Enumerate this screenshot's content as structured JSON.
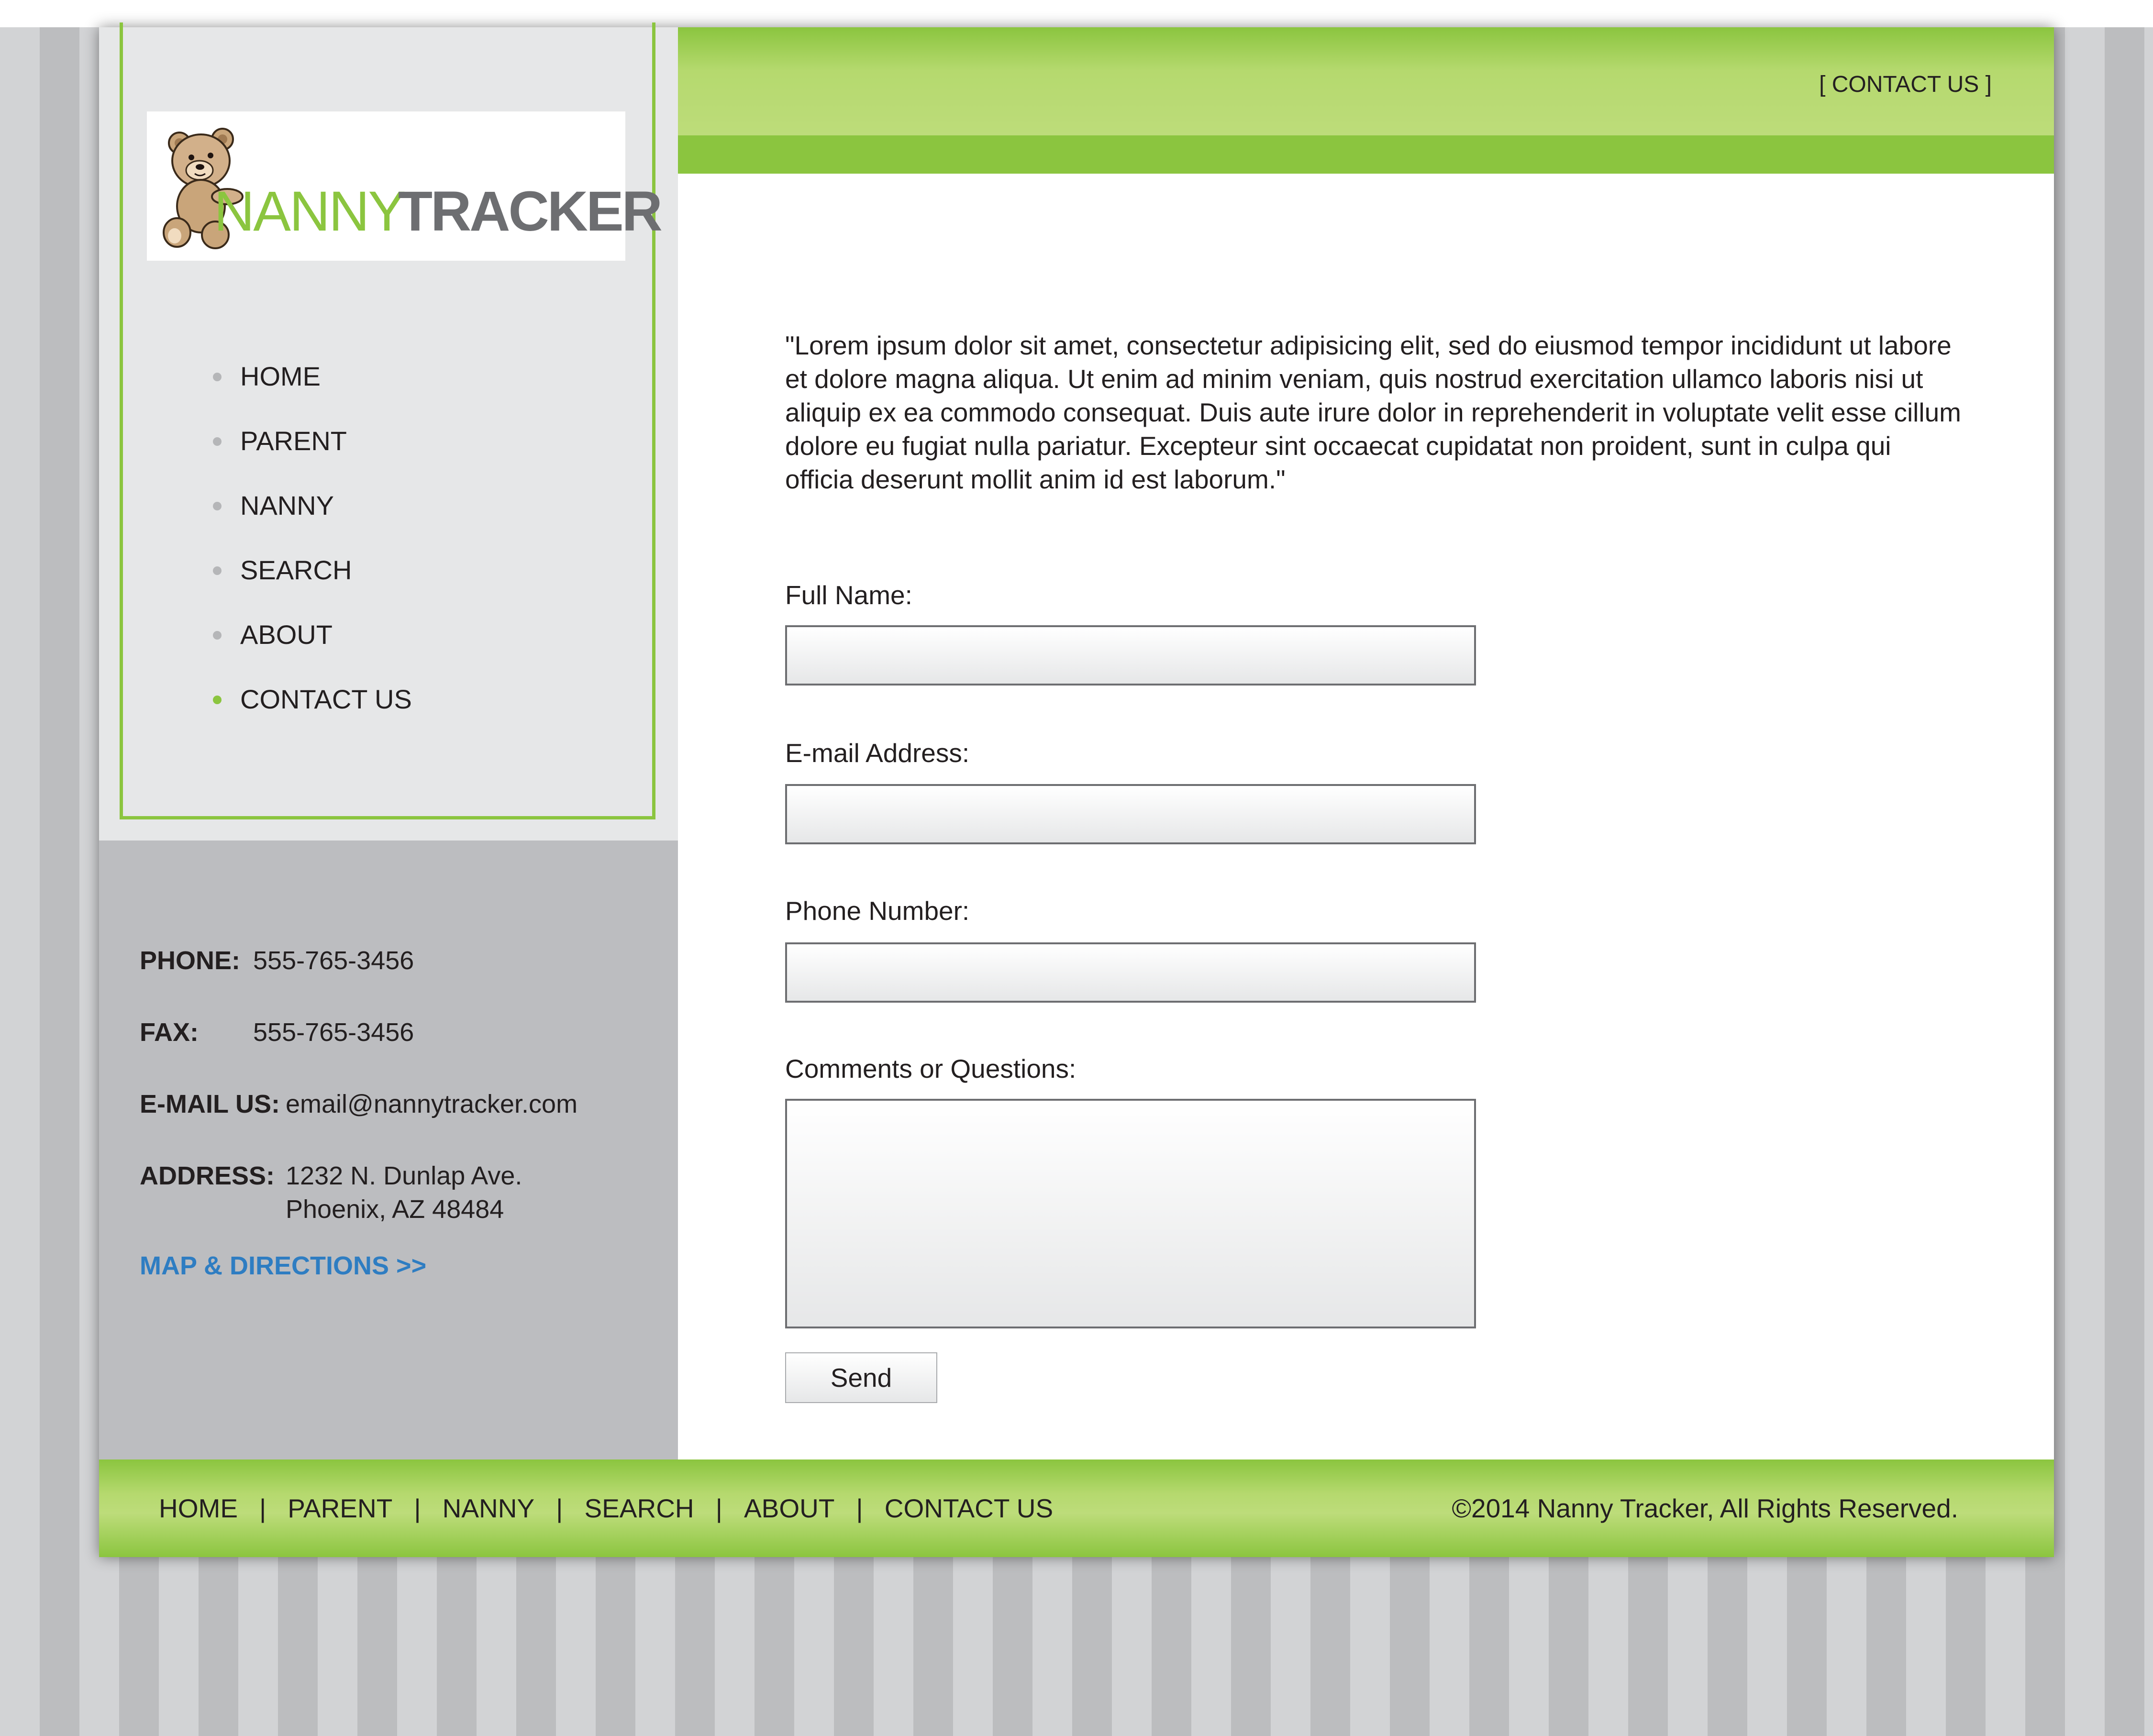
{
  "logo": {
    "text_a": "NANNY",
    "text_b": "TRACKER"
  },
  "header": {
    "contact_link": "[  CONTACT US ]"
  },
  "sidebar": {
    "items": [
      {
        "label": "HOME",
        "active": false
      },
      {
        "label": "PARENT",
        "active": false
      },
      {
        "label": "NANNY",
        "active": false
      },
      {
        "label": "SEARCH",
        "active": false
      },
      {
        "label": "ABOUT",
        "active": false
      },
      {
        "label": "CONTACT US",
        "active": true
      }
    ]
  },
  "contact_info": {
    "phone_label": "PHONE:",
    "phone": "555-765-3456",
    "fax_label": "FAX:",
    "fax": "555-765-3456",
    "email_label": "E-MAIL US:",
    "email": "email@nannytracker.com",
    "address_label": "ADDRESS:",
    "address_line1": "1232 N. Dunlap Ave.",
    "address_line2": "Phoenix, AZ 48484",
    "map_link": "MAP & DIRECTIONS >>"
  },
  "main": {
    "intro": "\"Lorem ipsum dolor sit amet, consectetur adipisicing elit, sed do eiusmod tempor incididunt ut labore et dolore magna aliqua. Ut enim ad minim veniam, quis nostrud exercitation ullamco laboris nisi ut aliquip ex ea commodo consequat. Duis aute irure dolor in reprehenderit in voluptate velit esse cillum dolore eu fugiat nulla pariatur. Excepteur sint occaecat cupidatat non proident, sunt in culpa qui officia deserunt mollit anim id est laborum.\"",
    "form": {
      "full_name_label": "Full Name:",
      "full_name_value": "",
      "email_label": "E-mail Address:",
      "email_value": "",
      "phone_label": "Phone Number:",
      "phone_value": "",
      "comments_label": "Comments or Questions:",
      "comments_value": "",
      "send_label": "Send"
    }
  },
  "footer": {
    "nav": [
      "HOME",
      "PARENT",
      "NANNY",
      "SEARCH",
      "ABOUT",
      "CONTACT US"
    ],
    "copyright": "©2014 Nanny Tracker, All Rights Reserved."
  },
  "colors": {
    "accent_green": "#8bc53f",
    "light_green": "#bddc7a",
    "link_blue": "#2e7dc2",
    "sidebar_gray": "#e6e7e8",
    "contact_gray": "#bcbdc0"
  }
}
